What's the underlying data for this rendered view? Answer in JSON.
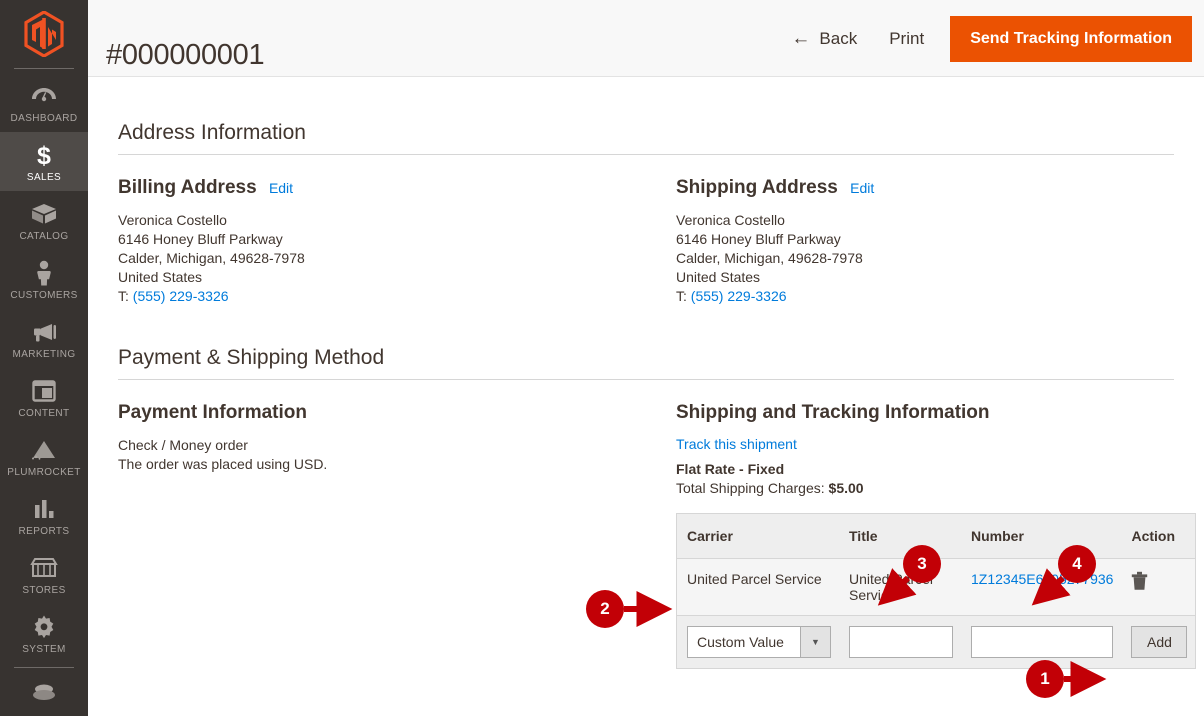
{
  "sidebar": {
    "logo": "magento-logo",
    "items": [
      {
        "label": "DASHBOARD",
        "icon": "dashboard-icon",
        "active": false
      },
      {
        "label": "SALES",
        "icon": "dollar-icon",
        "active": true
      },
      {
        "label": "CATALOG",
        "icon": "box-icon",
        "active": false
      },
      {
        "label": "CUSTOMERS",
        "icon": "person-icon",
        "active": false
      },
      {
        "label": "MARKETING",
        "icon": "megaphone-icon",
        "active": false
      },
      {
        "label": "CONTENT",
        "icon": "layout-icon",
        "active": false
      },
      {
        "label": "PLUMROCKET",
        "icon": "pyramid-icon",
        "active": false
      },
      {
        "label": "REPORTS",
        "icon": "bar-chart-icon",
        "active": false
      },
      {
        "label": "STORES",
        "icon": "storefront-icon",
        "active": false
      },
      {
        "label": "SYSTEM",
        "icon": "gear-icon",
        "active": false
      }
    ]
  },
  "header": {
    "title": "#000000001",
    "back_label": "Back",
    "back_icon": "arrow-left-icon",
    "print_label": "Print",
    "primary_label": "Send Tracking Information",
    "primary_color": "#eb5202"
  },
  "address_section": {
    "heading": "Address Information",
    "billing": {
      "heading": "Billing Address",
      "edit_label": "Edit",
      "name": "Veronica Costello",
      "street": "6146 Honey Bluff Parkway",
      "city_state_zip": "Calder, Michigan, 49628-7978",
      "country": "United States",
      "phone_prefix": "T:",
      "phone": "(555) 229-3326"
    },
    "shipping": {
      "heading": "Shipping Address",
      "edit_label": "Edit",
      "name": "Veronica Costello",
      "street": "6146 Honey Bluff Parkway",
      "city_state_zip": "Calder, Michigan, 49628-7978",
      "country": "United States",
      "phone_prefix": "T:",
      "phone": "(555) 229-3326"
    }
  },
  "payment_shipping_section": {
    "heading": "Payment & Shipping Method",
    "payment": {
      "heading": "Payment Information",
      "method": "Check / Money order",
      "currency_note": "The order was placed using USD."
    },
    "shipping": {
      "heading": "Shipping and Tracking Information",
      "track_link": "Track this shipment",
      "method": "Flat Rate - Fixed",
      "charges_label": "Total Shipping Charges:",
      "charges_value": "$5.00",
      "table": {
        "columns": [
          "Carrier",
          "Title",
          "Number",
          "Action"
        ],
        "rows": [
          {
            "carrier": "United Parcel Service",
            "title": "United Parcel Service",
            "number": "1Z12345E6205277936",
            "action_icon": "trash-icon"
          }
        ],
        "new_row": {
          "carrier_select_value": "Custom Value",
          "carrier_select_icon": "chevron-down-icon",
          "title_value": "",
          "title_placeholder": "",
          "number_value": "",
          "number_placeholder": "",
          "add_label": "Add"
        }
      }
    }
  },
  "annotations": {
    "color": "#c20006",
    "badges": [
      {
        "id": "1",
        "label": "1"
      },
      {
        "id": "2",
        "label": "2"
      },
      {
        "id": "3",
        "label": "3"
      },
      {
        "id": "4",
        "label": "4"
      }
    ]
  }
}
